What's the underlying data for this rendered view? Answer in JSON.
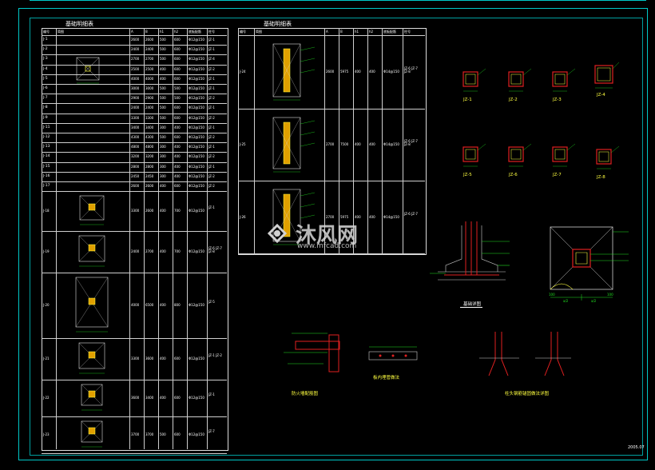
{
  "drawing": {
    "table_title": "基础明细表",
    "table2_title": "基础明细表",
    "date_stamp": "2005.07"
  },
  "table1": {
    "headers": [
      "编号",
      "简图",
      "A",
      "B",
      "h1",
      "h2",
      "底板配筋",
      "柱号"
    ],
    "rows": [
      {
        "id": "J-1",
        "a": "2600",
        "b": "2600",
        "h1": "500",
        "h2": "600",
        "rebar": "Φ12@150",
        "col": "JZ-1"
      },
      {
        "id": "J-2",
        "a": "2400",
        "b": "2400",
        "h1": "500",
        "h2": "600",
        "rebar": "Φ12@150",
        "col": "JZ-1"
      },
      {
        "id": "J-3",
        "a": "2700",
        "b": "2700",
        "h1": "500",
        "h2": "600",
        "rebar": "Φ12@150",
        "col": "JZ-4"
      },
      {
        "id": "J-4",
        "a": "2500",
        "b": "2500",
        "h1": "400",
        "h2": "600",
        "rebar": "Φ12@150",
        "col": "JZ-2"
      },
      {
        "id": "J-5",
        "a": "4000",
        "b": "4000",
        "h1": "400",
        "h2": "600",
        "rebar": "Φ12@150",
        "col": "JZ-1"
      },
      {
        "id": "J-6",
        "a": "3000",
        "b": "3000",
        "h1": "500",
        "h2": "500",
        "rebar": "Φ12@150",
        "col": "JZ-1"
      },
      {
        "id": "J-7",
        "a": "2900",
        "b": "2900",
        "h1": "500",
        "h2": "500",
        "rebar": "Φ12@150",
        "col": "JZ-2"
      },
      {
        "id": "J-8",
        "a": "2400",
        "b": "2400",
        "h1": "500",
        "h2": "600",
        "rebar": "Φ12@150",
        "col": "JZ-1"
      },
      {
        "id": "J-9",
        "a": "3300",
        "b": "3300",
        "h1": "500",
        "h2": "600",
        "rebar": "Φ12@150",
        "col": "JZ-2"
      },
      {
        "id": "J-11",
        "a": "3400",
        "b": "3400",
        "h1": "300",
        "h2": "400",
        "rebar": "Φ12@150",
        "col": "JZ-1"
      },
      {
        "id": "J-12",
        "a": "4300",
        "b": "4300",
        "h1": "500",
        "h2": "600",
        "rebar": "Φ12@150",
        "col": "JZ-2"
      },
      {
        "id": "J-13",
        "a": "4800",
        "b": "4800",
        "h1": "300",
        "h2": "400",
        "rebar": "Φ12@150",
        "col": "JZ-1"
      },
      {
        "id": "J-14",
        "a": "3200",
        "b": "3200",
        "h1": "300",
        "h2": "400",
        "rebar": "Φ12@150",
        "col": "JZ-2"
      },
      {
        "id": "J-15",
        "a": "2800",
        "b": "2800",
        "h1": "300",
        "h2": "400",
        "rebar": "Φ12@150",
        "col": "JZ-1"
      },
      {
        "id": "J-16",
        "a": "2450",
        "b": "2450",
        "h1": "300",
        "h2": "400",
        "rebar": "Φ12@150",
        "col": "JZ-2"
      },
      {
        "id": "J-17",
        "a": "2600",
        "b": "2600",
        "h1": "400",
        "h2": "600",
        "rebar": "Φ12@150",
        "col": "JZ-2"
      }
    ],
    "big_rows": [
      {
        "id": "J-18",
        "a": "3300",
        "b": "2600",
        "h1": "400",
        "h2": "700",
        "rebar": "Φ12@150",
        "col": "JZ-1"
      },
      {
        "id": "J-19",
        "a": "2400",
        "b": "2700",
        "h1": "400",
        "h2": "700",
        "rebar": "Φ12@150",
        "col": "JZ-6 JZ-7 JZ-8"
      },
      {
        "id": "J-20",
        "a": "4000",
        "b": "6500",
        "h1": "400",
        "h2": "800",
        "rebar": "Φ12@150",
        "col": "JZ-5"
      },
      {
        "id": "J-21",
        "a": "3300",
        "b": "3600",
        "h1": "400",
        "h2": "600",
        "rebar": "Φ12@150",
        "col": "JZ-1 JZ-2"
      },
      {
        "id": "J-22",
        "a": "3600",
        "b": "3400",
        "h1": "400",
        "h2": "600",
        "rebar": "Φ12@150",
        "col": "JZ-1"
      },
      {
        "id": "J-23",
        "a": "3700",
        "b": "3700",
        "h1": "500",
        "h2": "600",
        "rebar": "Φ12@150",
        "col": "JZ-7"
      }
    ]
  },
  "table2": {
    "headers": [
      "编号",
      "简图",
      "A",
      "B",
      "h1",
      "h2",
      "底板配筋",
      "柱号"
    ],
    "rows": [
      {
        "id": "J-24",
        "a": "2600",
        "b": "5975",
        "h1": "400",
        "h2": "400",
        "rebar": "Φ14@150",
        "col": "JZ-6 JZ-7 JZ-8"
      },
      {
        "id": "J-25",
        "a": "2700",
        "b": "7500",
        "h1": "400",
        "h2": "400",
        "rebar": "Φ14@150",
        "col": "JZ-6 JZ-7 JZ-8"
      },
      {
        "id": "J-26",
        "a": "2700",
        "b": "5975",
        "h1": "400",
        "h2": "400",
        "rebar": "Φ14@150",
        "col": "JZ-6 JZ-7"
      }
    ]
  },
  "columns": [
    "JZ-1",
    "JZ-2",
    "JZ-3",
    "JZ-4",
    "JZ-5",
    "JZ-6",
    "JZ-7",
    "JZ-8"
  ],
  "details": {
    "section_caption": "基础详图",
    "plan_dims": [
      "a/2",
      "a/2",
      "100",
      "100"
    ],
    "beam_caption": "防火墙配筋图",
    "pipe_caption": "板内埋管做法",
    "anchor_caption": "柱头钢筋锚固做法详图"
  },
  "watermark": {
    "brand": "沐风网",
    "url": "www.mfcad.com"
  },
  "colors": {
    "frame": "#00c8c8",
    "column_red": "#e02020",
    "rebar_yellow": "#ffff40",
    "dim_green": "#20e020",
    "text_white": "#ffffff"
  }
}
